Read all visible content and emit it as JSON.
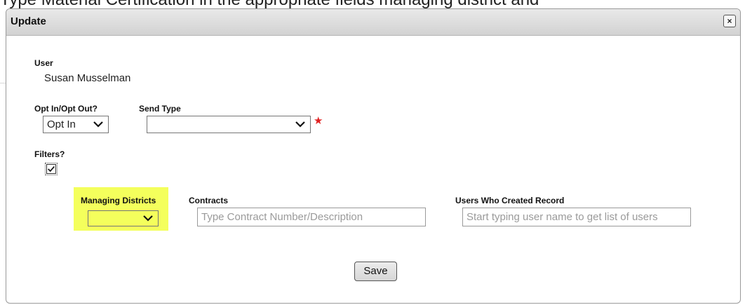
{
  "background": {
    "text": "Type Material Certification in the appropriate fields managing district and"
  },
  "dialog": {
    "title": "Update",
    "close_label": "×"
  },
  "user": {
    "label": "User",
    "value": "Susan Musselman"
  },
  "opt": {
    "label": "Opt In/Opt Out?",
    "selected": "Opt In"
  },
  "send_type": {
    "label": "Send Type",
    "selected": "",
    "required_icon": "red-star-icon"
  },
  "filters": {
    "label": "Filters?",
    "checked": true
  },
  "managing_districts": {
    "label": "Managing Districts",
    "selected": "",
    "highlight_color": "#f4ff5c"
  },
  "contracts": {
    "label": "Contracts",
    "placeholder": "Type Contract Number/Description"
  },
  "users_created": {
    "label": "Users Who Created Record",
    "placeholder": "Start typing user name to get list of users"
  },
  "save_label": "Save"
}
